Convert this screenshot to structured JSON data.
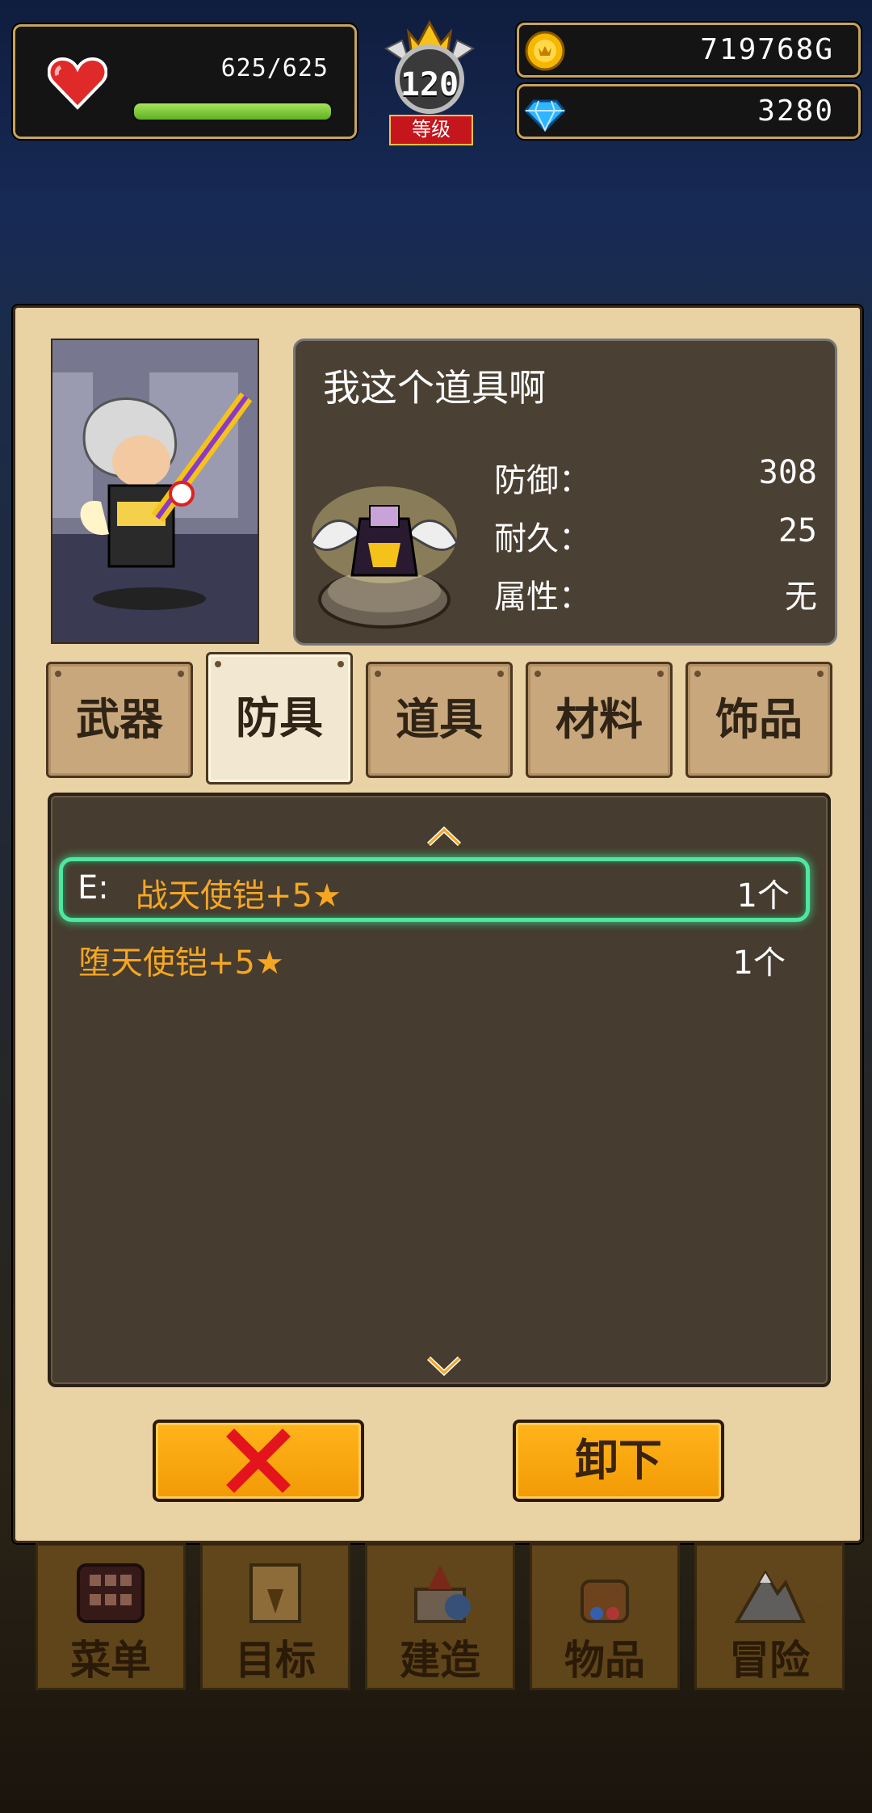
{
  "hud": {
    "hp_text": "625/625",
    "hp_fraction": 1.0,
    "level": "120",
    "level_label": "等级",
    "gold": "719768G",
    "gems": "3280"
  },
  "item_info": {
    "name": "我这个道具啊",
    "stats": [
      {
        "label": "防御：",
        "value": "308"
      },
      {
        "label": "耐久：",
        "value": "25"
      },
      {
        "label": "属性：",
        "value": "无"
      }
    ]
  },
  "tabs": [
    {
      "label": "武器",
      "active": false
    },
    {
      "label": "防具",
      "active": true
    },
    {
      "label": "道具",
      "active": false
    },
    {
      "label": "材料",
      "active": false
    },
    {
      "label": "饰品",
      "active": false
    }
  ],
  "list": {
    "items": [
      {
        "prefix": "E:",
        "name": "战天使铠+5★",
        "count": "1个",
        "selected": true
      },
      {
        "prefix": "",
        "name": "堕天使铠+5★",
        "count": "1个",
        "selected": false
      }
    ]
  },
  "buttons": {
    "close_icon": "close-x-icon",
    "unequip_label": "卸下"
  },
  "bottom_nav": [
    {
      "label": "菜单",
      "icon": "menu-grid-icon"
    },
    {
      "label": "目标",
      "icon": "quest-scroll-icon"
    },
    {
      "label": "建造",
      "icon": "castle-icon"
    },
    {
      "label": "物品",
      "icon": "bag-icon"
    },
    {
      "label": "冒险",
      "icon": "mountain-icon"
    }
  ],
  "colors": {
    "accent_orange": "#f5a623",
    "selection_green": "#4fe6a0",
    "button_orange": "#f29a05"
  }
}
